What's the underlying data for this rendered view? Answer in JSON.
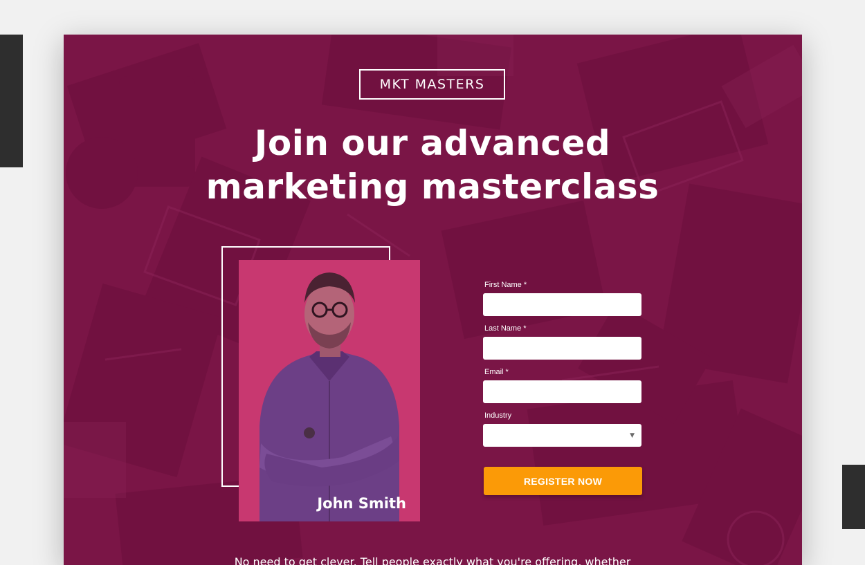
{
  "brand": {
    "logo_text": "MKT MASTERS"
  },
  "hero": {
    "headline_line1": "Join our advanced",
    "headline_line2": "marketing masterclass"
  },
  "speaker": {
    "name": "John Smith"
  },
  "form": {
    "fields": [
      {
        "label": "First Name *",
        "value": ""
      },
      {
        "label": "Last Name *",
        "value": ""
      },
      {
        "label": "Email *",
        "value": ""
      },
      {
        "label": "Industry",
        "value": ""
      }
    ],
    "select_arrow_icon": "caret-down-icon",
    "submit_label": "REGISTER NOW"
  },
  "body": {
    "intro": "No need to get clever. Tell people exactly what you're offering, whether"
  },
  "colors": {
    "page_background": "#f1f1f1",
    "hero_background": "#7a1546",
    "photo_background": "#c83870",
    "cta": "#fb9a07",
    "side_blocks": "#2e2e2e"
  }
}
